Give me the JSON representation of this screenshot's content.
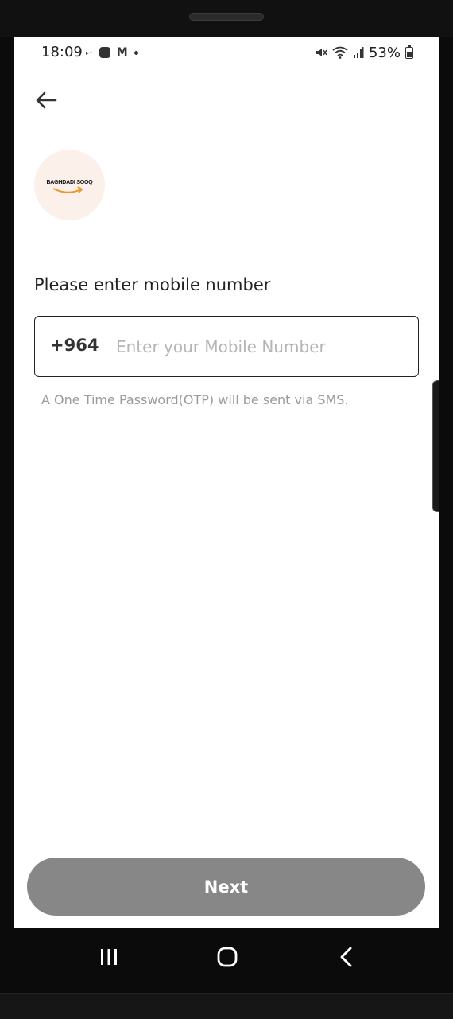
{
  "status_bar": {
    "time": "18:09",
    "battery_percent": "53%",
    "icons_left": [
      "carrier-icon",
      "pay-icon",
      "gmail-icon",
      "notification-dot-icon"
    ],
    "icons_right": [
      "mute-icon",
      "wifi-icon",
      "signal-icon",
      "battery-icon"
    ]
  },
  "header": {
    "back_icon": "arrow-left-icon"
  },
  "logo": {
    "text": "BAGHDADI SOOQ",
    "background": "#fcf1ea",
    "arrow_color": "#e89a2e"
  },
  "form": {
    "label": "Please enter mobile number",
    "country_code": "+964",
    "phone_value": "",
    "phone_placeholder": "Enter your Mobile Number",
    "helper": "A One Time Password(OTP) will be sent via SMS."
  },
  "actions": {
    "next_label": "Next",
    "next_color": "#878787"
  },
  "system_nav": {
    "items": [
      "recents-icon",
      "home-icon",
      "back-icon"
    ]
  }
}
